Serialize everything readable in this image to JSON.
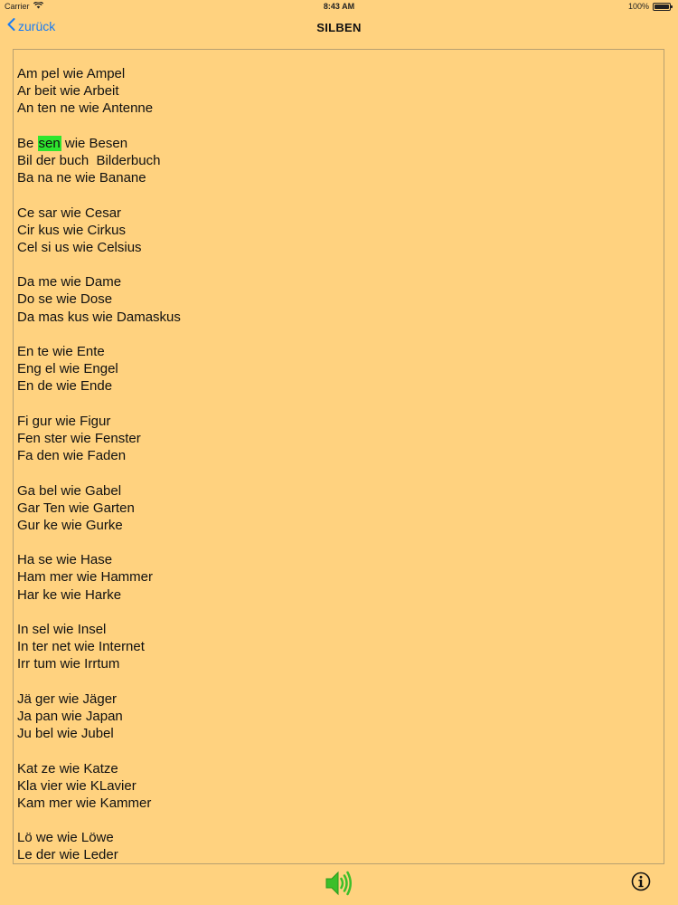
{
  "status": {
    "carrier": "Carrier",
    "time": "8:43 AM",
    "battery": "100%",
    "battery_level": 1.0
  },
  "nav": {
    "back_label": "zurück",
    "title": "SILBEN"
  },
  "content": {
    "groups": [
      {
        "lines": [
          "Am pel wie Ampel",
          "Ar beit wie Arbeit",
          "An ten ne wie Antenne"
        ]
      },
      {
        "lines": [
          {
            "before": "Be ",
            "highlight": "sen",
            "after": " wie Besen"
          },
          "Bil der buch  Bilderbuch",
          "Ba na ne wie Banane"
        ]
      },
      {
        "lines": [
          "Ce sar wie Cesar",
          "Cir kus wie Cirkus",
          "Cel si us wie Celsius"
        ]
      },
      {
        "lines": [
          "Da me wie Dame",
          "Do se wie Dose",
          "Da mas kus wie Damaskus"
        ]
      },
      {
        "lines": [
          "En te wie Ente",
          "Eng el wie Engel",
          "En de wie Ende"
        ]
      },
      {
        "lines": [
          "Fi gur wie Figur",
          "Fen ster wie Fenster",
          "Fa den wie Faden"
        ]
      },
      {
        "lines": [
          "Ga bel wie Gabel",
          "Gar Ten wie Garten",
          "Gur ke wie Gurke"
        ]
      },
      {
        "lines": [
          "Ha se wie Hase",
          "Ham mer wie Hammer",
          "Har ke wie Harke"
        ]
      },
      {
        "lines": [
          "In sel wie Insel",
          "In ter net wie Internet",
          "Irr tum wie Irrtum"
        ]
      },
      {
        "lines": [
          "Jä ger wie Jäger",
          "Ja pan wie Japan",
          "Ju bel wie Jubel"
        ]
      },
      {
        "lines": [
          "Kat ze wie Katze",
          "Kla vier wie KLavier",
          "Kam mer wie Kammer"
        ]
      },
      {
        "lines": [
          "Lö we wie Löwe",
          "Le der wie Leder"
        ]
      }
    ]
  },
  "toolbar": {
    "speaker_icon": "speaker-icon",
    "info_icon": "info-icon"
  },
  "colors": {
    "background": "#FFD27F",
    "accent": "#1B7CF2",
    "highlight": "#2EE62E",
    "speaker": "#3CBF2A"
  }
}
